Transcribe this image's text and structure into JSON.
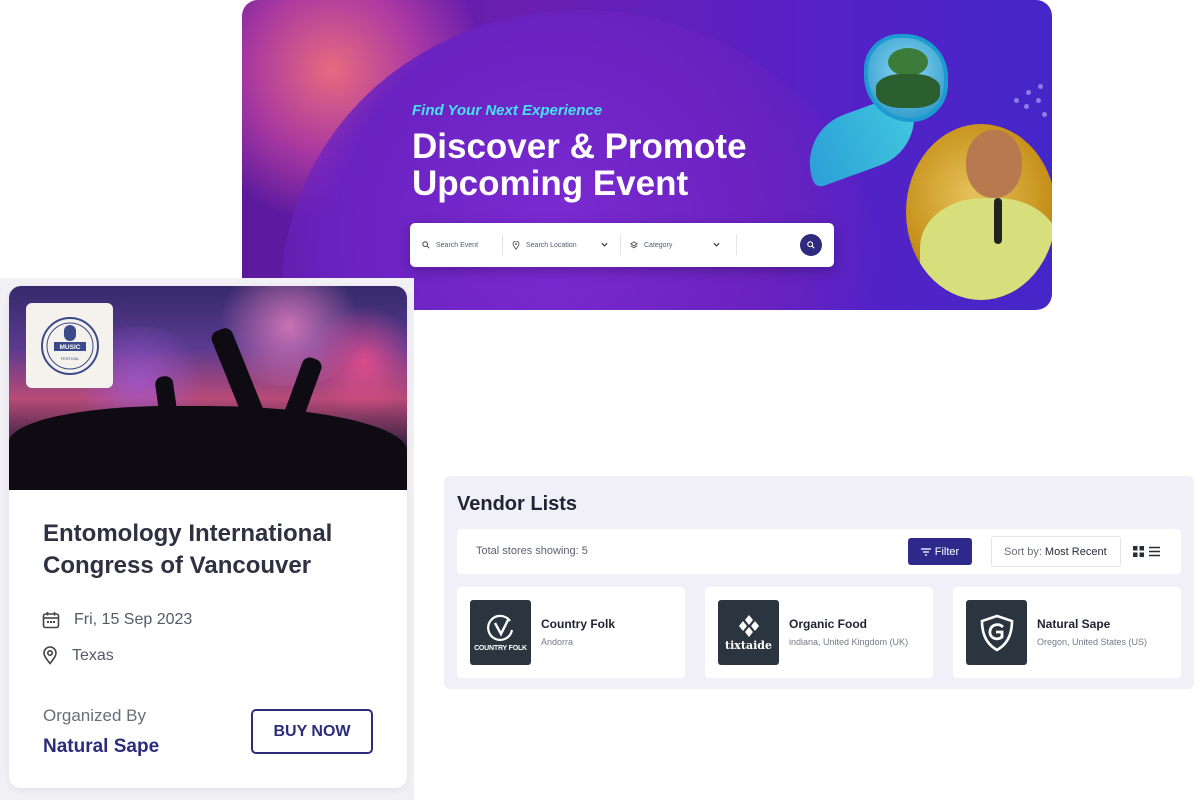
{
  "hero": {
    "kicker": "Find Your Next Experience",
    "headline": "Discover & Promote Upcoming Event",
    "search": {
      "event_placeholder": "Search Event",
      "location_placeholder": "Search Location",
      "category_placeholder": "Category"
    },
    "colors": {
      "accent": "#47e3f2",
      "primary": "#2d2a7f"
    }
  },
  "event_card": {
    "badge_text": "MUSIC",
    "badge_subtext": "FESTIVAL",
    "title": "Entomology International Congress of Vancouver",
    "date": "Fri, 15 Sep 2023",
    "location": "Texas",
    "organized_label": "Organized By",
    "organizer": "Natural Sape",
    "buy_label": "BUY NOW"
  },
  "vendors": {
    "title": "Vendor Lists",
    "count_text": "Total stores showing: 5",
    "filter_label": "Filter",
    "sort_label": "Sort by:",
    "sort_value": "Most Recent",
    "items": [
      {
        "name": "Country Folk",
        "location": "Andorra",
        "logo_text": "COUNTRY FOLK",
        "logo_icon": "circle-v-icon"
      },
      {
        "name": "Organic Food",
        "location": "indiana, United Kingdom (UK)",
        "logo_text": "tixtaide",
        "logo_icon": "diamond-icon"
      },
      {
        "name": "Natural Sape",
        "location": "Oregon, United States (US)",
        "logo_text": "",
        "logo_icon": "shield-g-icon"
      }
    ]
  }
}
